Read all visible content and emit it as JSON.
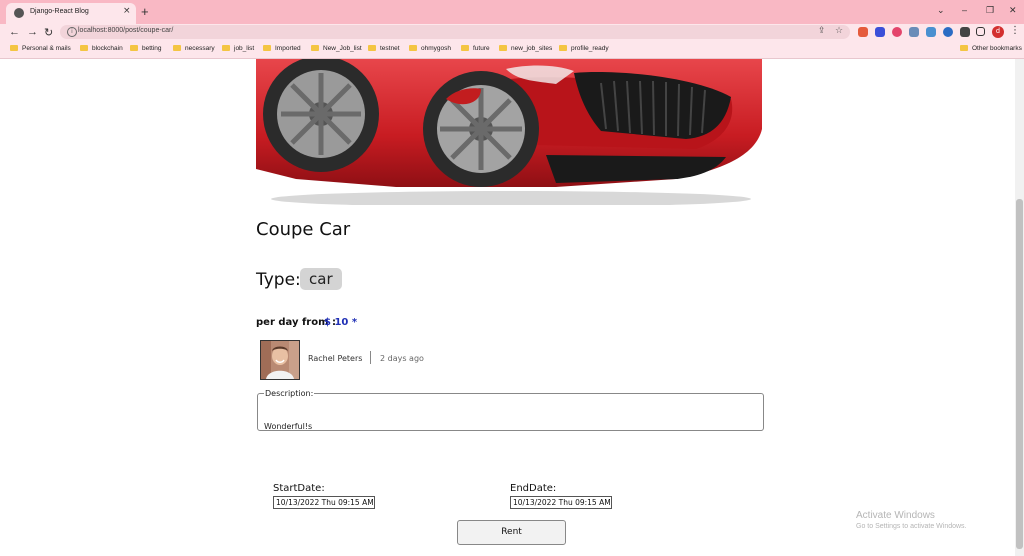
{
  "browser": {
    "tab_title": "Django-React Blog",
    "url": "localhost:8000/post/coupe-car/",
    "bookmarks": [
      "Personal & mails",
      "blockchain",
      "betting",
      "necessary",
      "job_list",
      "Imported",
      "New_Job_list",
      "testnet",
      "ohmygosh",
      "future",
      "new_job_sites",
      "profile_ready"
    ],
    "other_bookmarks": "Other bookmarks",
    "profile_initial": "d",
    "new_tab": "+",
    "tab_close": "×",
    "win_minimize": "–",
    "win_restore": "❐",
    "win_close": "✕",
    "win_dropdown": "⌄"
  },
  "post": {
    "title": "Coupe Car",
    "type_label": "Type:",
    "type_value": "car",
    "price_label": "per day from :",
    "price_value": "$ 10 *",
    "author": "Rachel Peters",
    "time_ago": "2 days ago",
    "description_legend": "Description:",
    "description": "Wonderful!s"
  },
  "booking": {
    "start_label": "StartDate:",
    "start_value": "10/13/2022  Thu 09:15 AM",
    "end_label": "EndDate:",
    "end_value": "10/13/2022  Thu 09:15 AM",
    "rent_button": "Rent"
  },
  "windows_watermark": {
    "title": "Activate Windows",
    "subtitle": "Go to Settings to activate Windows."
  },
  "colors": {
    "tab_bar": "#f9b8c4",
    "toolbar": "#fde6eb",
    "price_accent": "#1f2fb5",
    "car_red": "#d31f24"
  }
}
